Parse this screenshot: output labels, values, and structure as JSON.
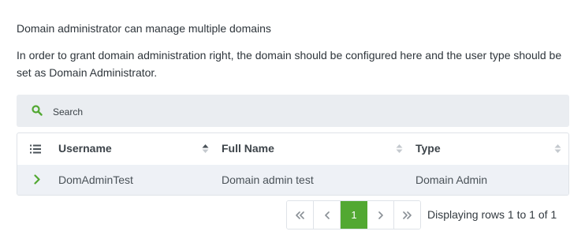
{
  "intro": {
    "line1": "Domain administrator can manage multiple domains",
    "line2": "In order to grant domain administration right, the domain should be configured here and the user type should be set as Domain Administrator."
  },
  "search": {
    "placeholder": "Search",
    "icon": "search-icon"
  },
  "table": {
    "columns": [
      "Username",
      "Full Name",
      "Type"
    ],
    "rows": [
      {
        "username": "DomAdminTest",
        "full_name": "Domain admin test",
        "type": "Domain Admin"
      }
    ]
  },
  "pagination": {
    "current_page": "1",
    "info": "Displaying rows 1 to 1 of 1"
  },
  "colors": {
    "accent": "#52a832",
    "search_bg": "#eaedf1",
    "row_bg": "#eef1f6"
  }
}
